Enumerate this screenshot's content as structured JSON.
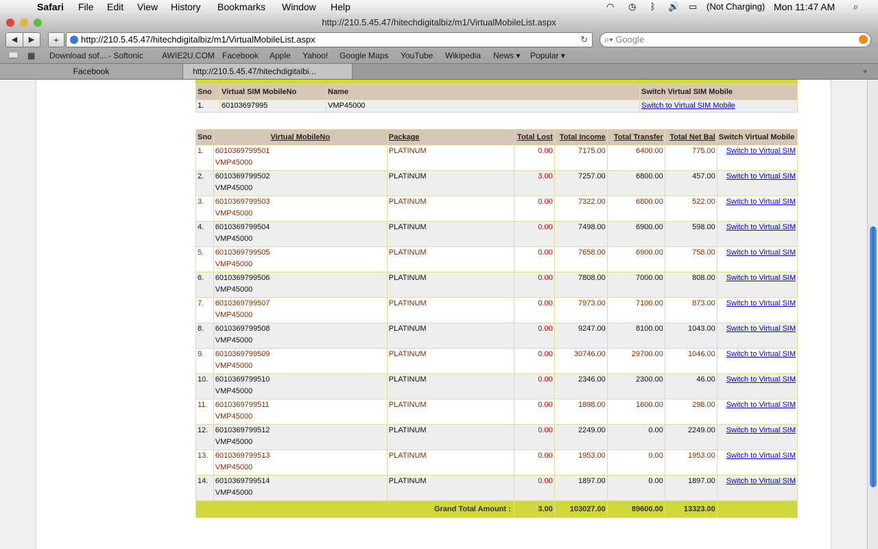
{
  "menubar": {
    "app": "Safari",
    "menus": [
      "File",
      "Edit",
      "View",
      "History",
      "Bookmarks",
      "Window",
      "Help"
    ],
    "battery": "(Not Charging)",
    "clock": "Mon 11:47 AM"
  },
  "window": {
    "title": "http://210.5.45.47/hitechdigitalbiz/m1/VirtualMobileList.aspx"
  },
  "toolbar": {
    "url": "http://210.5.45.47/hitechdigitalbiz/m1/VirtualMobileList.aspx",
    "search_placeholder": "Google"
  },
  "bookmarks": [
    "Download sof... - Softonic",
    "AWIE2U.COM",
    "Facebook",
    "Apple",
    "Yahoo!",
    "Google Maps",
    "YouTube",
    "Wikipedia",
    "News ▾",
    "Popular ▾"
  ],
  "tabs": [
    {
      "label": "Facebook"
    },
    {
      "label": "http://210.5.45.47/hitechdigitalbi..."
    }
  ],
  "sim_table": {
    "headers": [
      "Sno",
      "Virtual SIM MobileNo",
      "Name",
      "Switch Virtual SIM Mobile"
    ],
    "row": {
      "sno": "1.",
      "mobile": "60103697995",
      "name": "VMP45000",
      "link": "Switch to Virtual SIM Mobile"
    }
  },
  "mobile_table": {
    "headers": [
      "Sno",
      "Virtual MobileNo",
      "Package",
      "Total Lost",
      "Total Income",
      "Total Transfer",
      "Total Net Bal",
      "Switch Virtual Mobile"
    ],
    "link_label": "Switch to Virtual SIM",
    "rows": [
      {
        "sno": "1.",
        "mobile": "6010369799501",
        "name": "VMP45000",
        "package": "PLATINUM",
        "lost": "0.00",
        "income": "7175.00",
        "transfer": "6400.00",
        "net": "775.00"
      },
      {
        "sno": "2.",
        "mobile": "6010369799502",
        "name": "VMP45000",
        "package": "PLATINUM",
        "lost": "3.00",
        "income": "7257.00",
        "transfer": "6800.00",
        "net": "457.00"
      },
      {
        "sno": "3.",
        "mobile": "6010369799503",
        "name": "VMP45000",
        "package": "PLATINUM",
        "lost": "0.00",
        "income": "7322.00",
        "transfer": "6800.00",
        "net": "522.00"
      },
      {
        "sno": "4.",
        "mobile": "6010369799504",
        "name": "VMP45000",
        "package": "PLATINUM",
        "lost": "0.00",
        "income": "7498.00",
        "transfer": "6900.00",
        "net": "598.00"
      },
      {
        "sno": "5.",
        "mobile": "6010369799505",
        "name": "VMP45000",
        "package": "PLATINUM",
        "lost": "0.00",
        "income": "7658.00",
        "transfer": "6900.00",
        "net": "758.00"
      },
      {
        "sno": "6.",
        "mobile": "6010369799506",
        "name": "VMP45000",
        "package": "PLATINUM",
        "lost": "0.00",
        "income": "7808.00",
        "transfer": "7000.00",
        "net": "808.00"
      },
      {
        "sno": "7.",
        "mobile": "6010369799507",
        "name": "VMP45000",
        "package": "PLATINUM",
        "lost": "0.00",
        "income": "7973.00",
        "transfer": "7100.00",
        "net": "873.00"
      },
      {
        "sno": "8.",
        "mobile": "6010369799508",
        "name": "VMP45000",
        "package": "PLATINUM",
        "lost": "0.00",
        "income": "9247.00",
        "transfer": "8100.00",
        "net": "1043.00"
      },
      {
        "sno": "9.",
        "mobile": "6010369799509",
        "name": "VMP45000",
        "package": "PLATINUM",
        "lost": "0.00",
        "income": "30746.00",
        "transfer": "29700.00",
        "net": "1046.00"
      },
      {
        "sno": "10.",
        "mobile": "6010369799510",
        "name": "VMP45000",
        "package": "PLATINUM",
        "lost": "0.00",
        "income": "2346.00",
        "transfer": "2300.00",
        "net": "46.00"
      },
      {
        "sno": "11.",
        "mobile": "6010369799511",
        "name": "VMP45000",
        "package": "PLATINUM",
        "lost": "0.00",
        "income": "1898.00",
        "transfer": "1600.00",
        "net": "298.00"
      },
      {
        "sno": "12.",
        "mobile": "6010369799512",
        "name": "VMP45000",
        "package": "PLATINUM",
        "lost": "0.00",
        "income": "2249.00",
        "transfer": "0.00",
        "net": "2249.00"
      },
      {
        "sno": "13.",
        "mobile": "6010369799513",
        "name": "VMP45000",
        "package": "PLATINUM",
        "lost": "0.00",
        "income": "1953.00",
        "transfer": "0.00",
        "net": "1953.00"
      },
      {
        "sno": "14.",
        "mobile": "6010369799514",
        "name": "VMP45000",
        "package": "PLATINUM",
        "lost": "0.00",
        "income": "1897.00",
        "transfer": "0.00",
        "net": "1897.00"
      }
    ],
    "totals": {
      "label": "Grand Total Amount :",
      "lost": "3.00",
      "income": "103027.00",
      "transfer": "89600.00",
      "net": "13323.00"
    }
  },
  "colors": {
    "header_bg": "#d6c6b5",
    "total_bg": "#cfd93b",
    "odd_text": "#8a2a00",
    "lost_text": "#dd0000",
    "link": "#0000ee"
  }
}
